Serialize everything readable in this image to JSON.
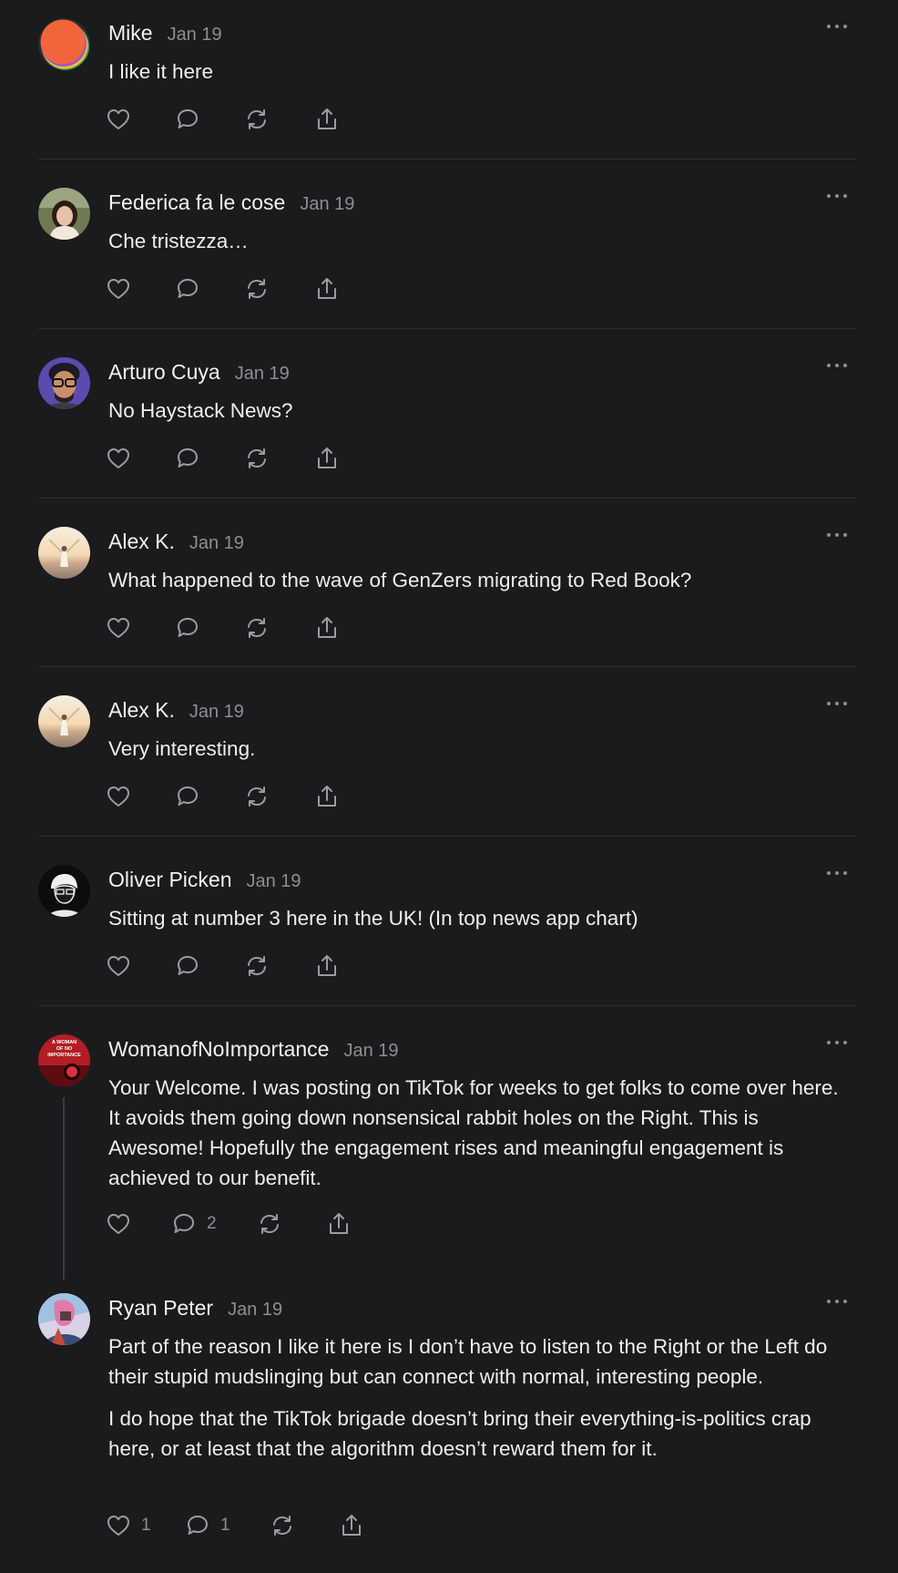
{
  "posts": [
    {
      "author": "Mike",
      "date": "Jan 19",
      "body": [
        "I like it here"
      ],
      "avatar": "gradient-circle-avatar",
      "counts": {
        "like": "",
        "reply": "",
        "repost": ""
      }
    },
    {
      "author": "Federica fa le cose",
      "date": "Jan 19",
      "body": [
        "Che tristezza…"
      ],
      "avatar": "photo-avatar",
      "counts": {
        "like": "",
        "reply": "",
        "repost": ""
      }
    },
    {
      "author": "Arturo Cuya",
      "date": "Jan 19",
      "body": [
        "No Haystack News?"
      ],
      "avatar": "cartoon-avatar",
      "counts": {
        "like": "",
        "reply": "",
        "repost": ""
      }
    },
    {
      "author": "Alex K.",
      "date": "Jan 19",
      "body": [
        "What happened to the wave of GenZers migrating to Red Book?"
      ],
      "avatar": "beach-photo-avatar",
      "counts": {
        "like": "",
        "reply": "",
        "repost": ""
      }
    },
    {
      "author": "Alex K.",
      "date": "Jan 19",
      "body": [
        "Very interesting."
      ],
      "avatar": "beach-photo-avatar",
      "counts": {
        "like": "",
        "reply": "",
        "repost": ""
      }
    },
    {
      "author": "Oliver Picken",
      "date": "Jan 19",
      "body": [
        "Sitting at number 3 here in the UK! (In top news app chart)"
      ],
      "avatar": "sketch-avatar",
      "counts": {
        "like": "",
        "reply": "",
        "repost": ""
      }
    },
    {
      "author": "WomanofNoImportance",
      "date": "Jan 19",
      "body": [
        "Your Welcome. I was posting on TikTok for weeks to get folks to come over here. It avoids them going down nonsensical rabbit holes on the Right. This is Awesome! Hopefully the engagement rises and meaningful engagement is achieved to our benefit."
      ],
      "avatar": "book-cover-avatar",
      "avatar_text": [
        "A WOMAN",
        "OF NO",
        "IMPORTANCE"
      ],
      "counts": {
        "like": "",
        "reply": "2",
        "repost": ""
      }
    },
    {
      "author": "Ryan Peter",
      "date": "Jan 19",
      "body": [
        "Part of the reason I like it here is I don’t have to listen to the Right or the Left do their stupid mudslinging but can connect with normal, interesting people.",
        "I do hope that the TikTok brigade doesn’t bring their everything-is-politics crap here, or at least that the algorithm doesn’t reward them for it."
      ],
      "avatar": "illustration-avatar",
      "counts": {
        "like": "1",
        "reply": "1",
        "repost": ""
      }
    }
  ],
  "colors": {
    "background": "#1a1b1d",
    "divider": "#2e2f32",
    "muted": "#8d8e91",
    "text": "#eeeeee"
  }
}
